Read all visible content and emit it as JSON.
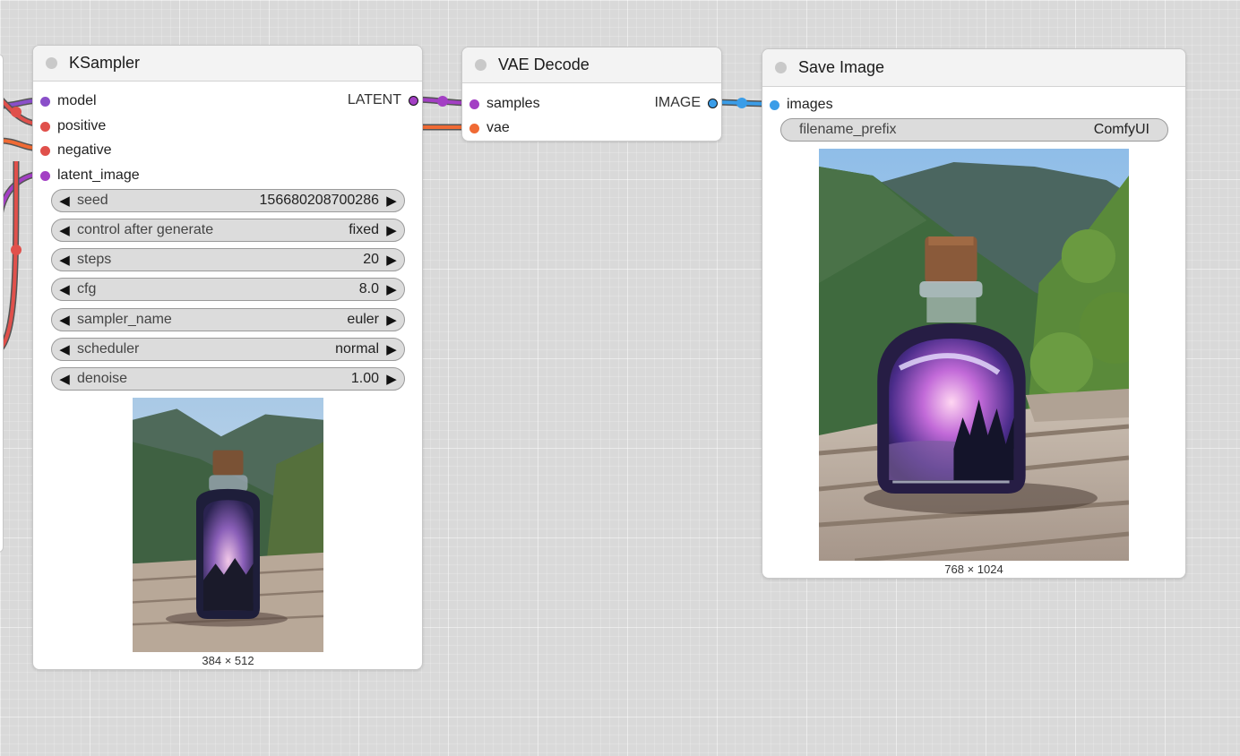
{
  "colors": {
    "model": "#8a4fc9",
    "positive": "#e0504b",
    "negative": "#e0504b",
    "latent": "#a33fc4",
    "vae": "#f06a34",
    "image": "#3a9de8"
  },
  "ksampler": {
    "title": "KSampler",
    "inputs": [
      "model",
      "positive",
      "negative",
      "latent_image"
    ],
    "output": "LATENT",
    "widgets": [
      {
        "label": "seed",
        "value": "156680208700286"
      },
      {
        "label": "control after generate",
        "value": "fixed"
      },
      {
        "label": "steps",
        "value": "20"
      },
      {
        "label": "cfg",
        "value": "8.0"
      },
      {
        "label": "sampler_name",
        "value": "euler"
      },
      {
        "label": "scheduler",
        "value": "normal"
      },
      {
        "label": "denoise",
        "value": "1.00"
      }
    ],
    "preview_caption": "384 × 512"
  },
  "vae_decode": {
    "title": "VAE Decode",
    "inputs": [
      "samples",
      "vae"
    ],
    "output": "IMAGE"
  },
  "save_image": {
    "title": "Save Image",
    "input": "images",
    "widget": {
      "label": "filename_prefix",
      "value": "ComfyUI"
    },
    "preview_caption": "768 × 1024"
  }
}
